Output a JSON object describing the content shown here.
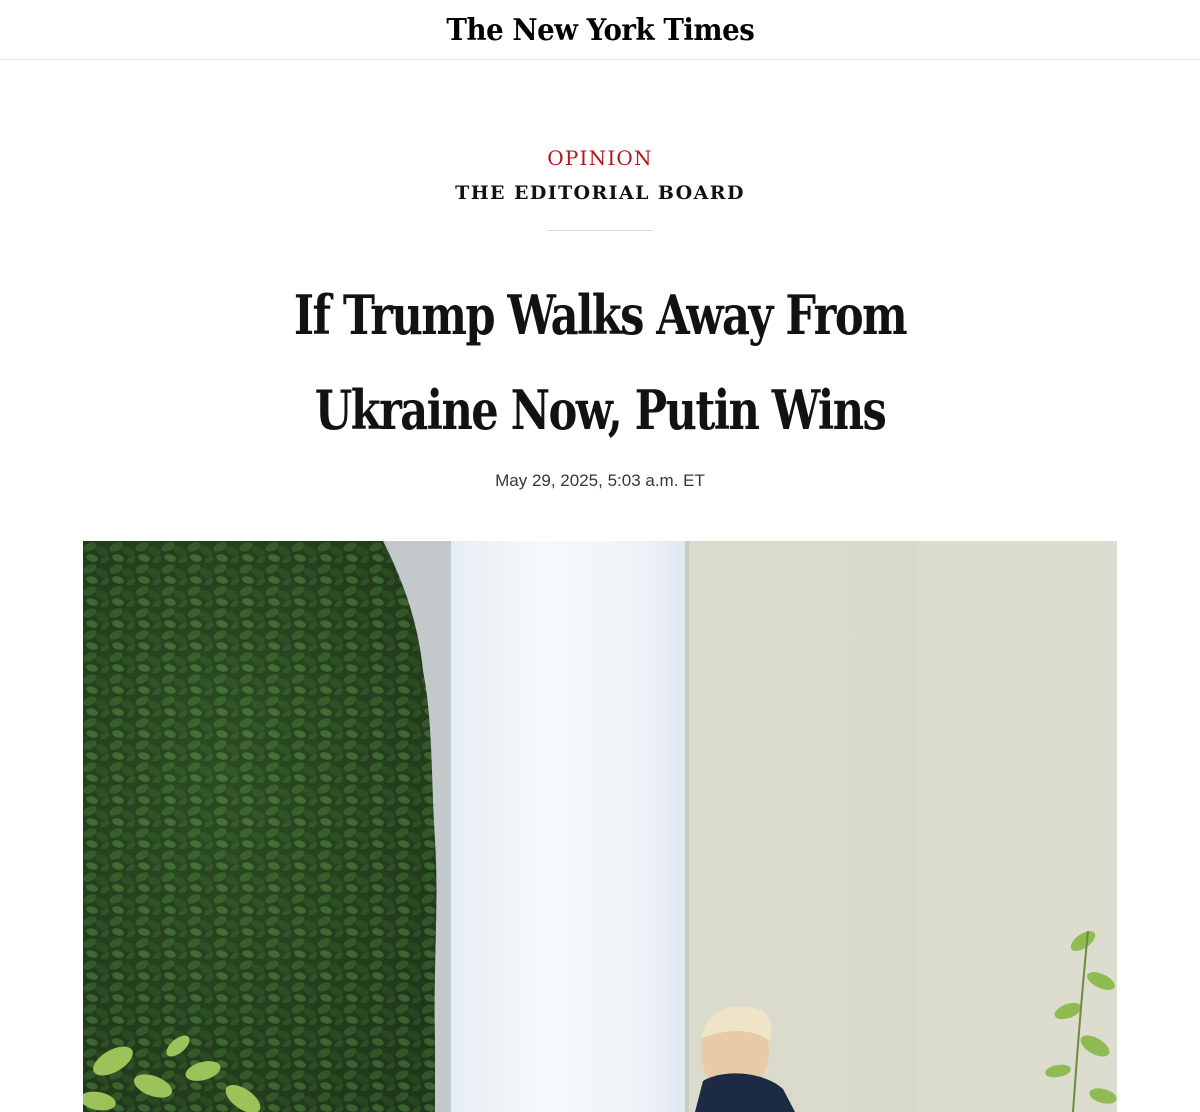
{
  "masthead": {
    "logo_text": "The New York Times"
  },
  "article": {
    "section": "OPINION",
    "byline": "THE EDITORIAL BOARD",
    "headline": "If Trump Walks Away From Ukraine Now, Putin Wins",
    "dateline": "May 29, 2025, 5:03 a.m. ET"
  },
  "colors": {
    "section_red": "#b3161d",
    "text": "#121212",
    "hedge_green": "#2f4a24",
    "column_white": "#f2f6fa",
    "wall_beige": "#d6d7c8"
  }
}
